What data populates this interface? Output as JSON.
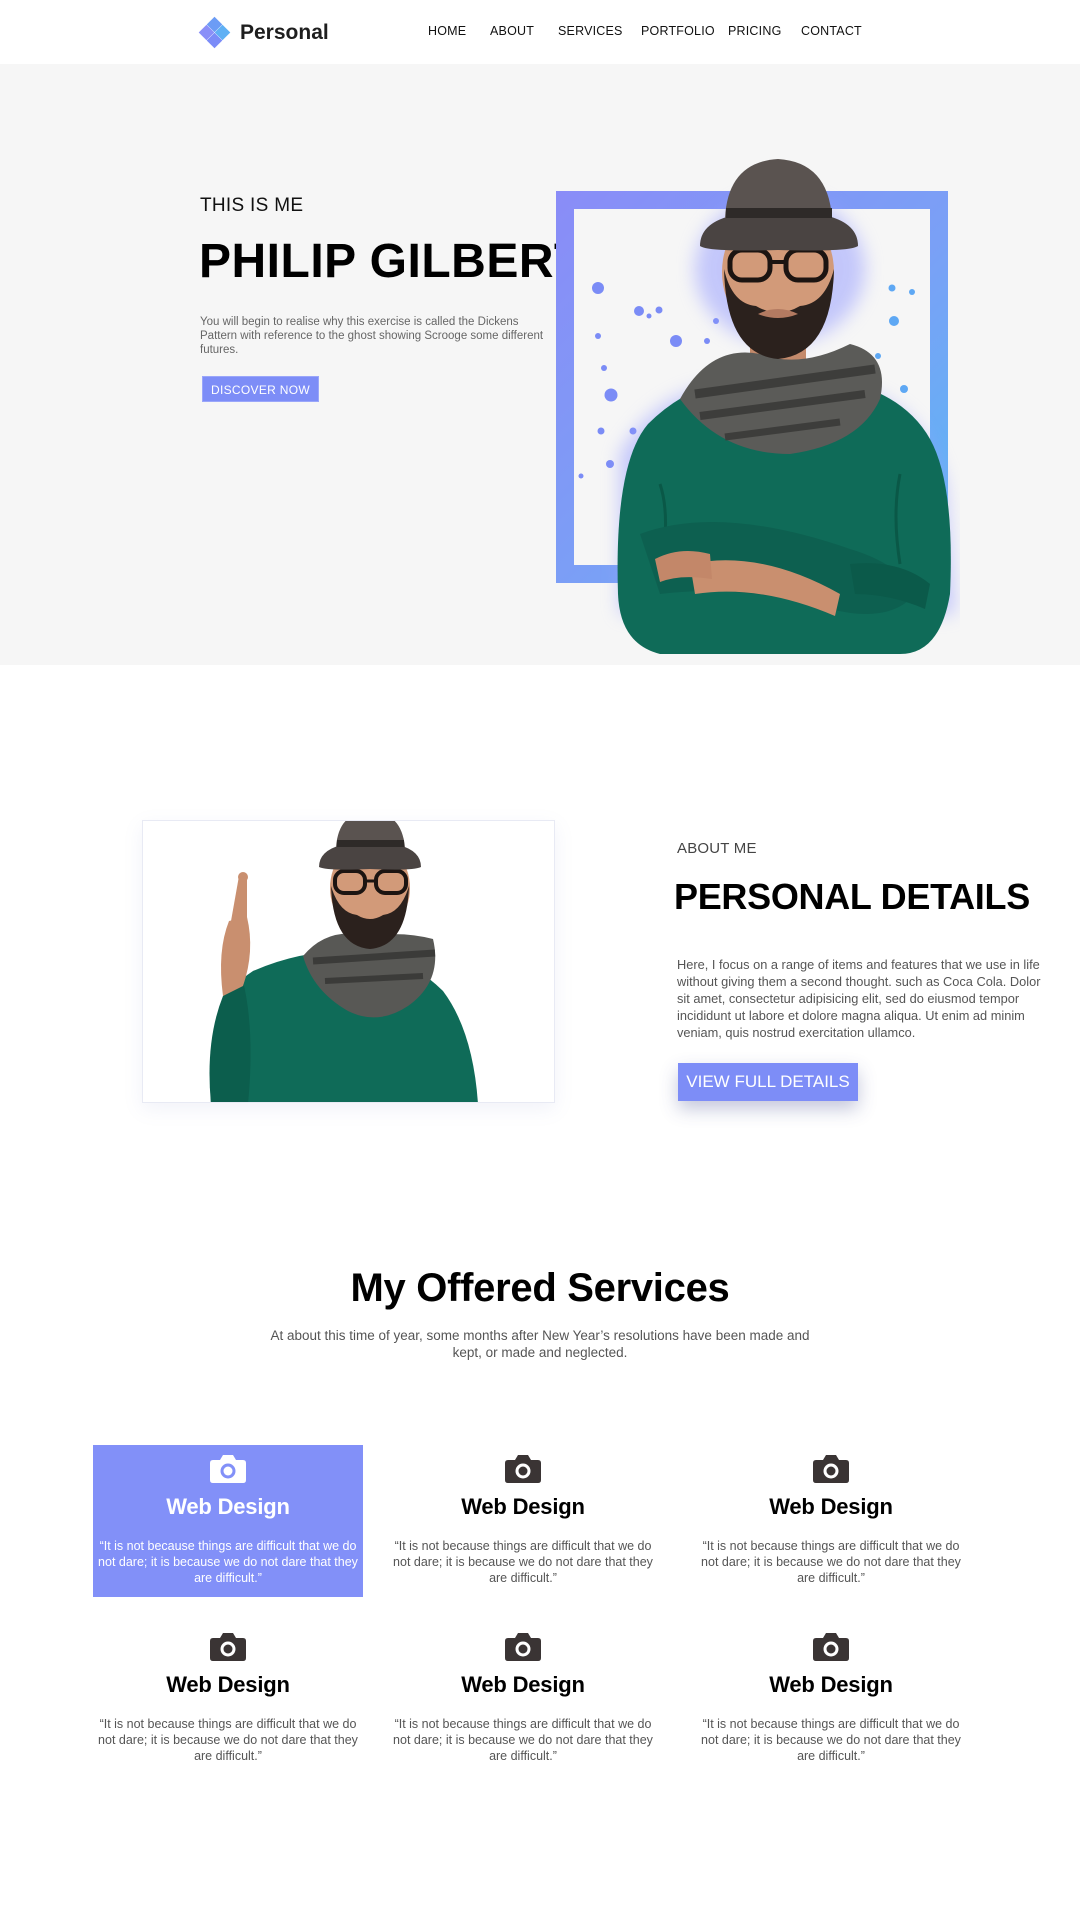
{
  "nav": {
    "logo_text": "Personal",
    "items": [
      "HOME",
      "ABOUT",
      "SERVICES",
      "PORTFOLIO",
      "PRICING",
      "CONTACT"
    ]
  },
  "hero": {
    "kicker": "THIS IS ME",
    "name": "PHILIP GILBERT",
    "description": "You will begin to realise why this exercise is called the Dickens Pattern with reference to the ghost showing Scrooge some different futures.",
    "button": "DISCOVER NOW"
  },
  "about": {
    "kicker": "ABOUT ME",
    "title": "PERSONAL DETAILS",
    "text": "Here, I focus on a range of items and features that we use in life without giving them a second thought. such as Coca Cola. Dolor sit amet, consectetur adipisicing elit, sed do eiusmod tempor incididunt ut labore et dolore magna aliqua. Ut enim ad minim veniam, quis nostrud exercitation ullamco.",
    "button": "VIEW FULL DETAILS"
  },
  "services": {
    "title": "My Offered Services",
    "subtitle": "At about this time of year, some months after New Year’s resolutions have been made and kept, or made and neglected.",
    "cards": [
      {
        "icon": "camera-icon",
        "title": "Web Design",
        "text": "“It is not because things are difficult that we do not dare; it is because we do not dare that they are difficult.”",
        "active": true
      },
      {
        "icon": "camera-icon",
        "title": "Web Design",
        "text": "“It is not because things are difficult that we do not dare; it is because we do not dare that they are difficult.”",
        "active": false
      },
      {
        "icon": "camera-icon",
        "title": "Web Design",
        "text": "“It is not because things are difficult that we do not dare; it is because we do not dare that they are difficult.”",
        "active": false
      },
      {
        "icon": "camera-icon",
        "title": "Web Design",
        "text": "“It is not because things are difficult that we do not dare; it is because we do not dare that they are difficult.”",
        "active": false
      },
      {
        "icon": "camera-icon",
        "title": "Web Design",
        "text": "“It is not because things are difficult that we do not dare; it is because we do not dare that they are difficult.”",
        "active": false
      },
      {
        "icon": "camera-icon",
        "title": "Web Design",
        "text": "“It is not because things are difficult that we do not dare; it is because we do not dare that they are difficult.”",
        "active": false
      }
    ]
  },
  "colors": {
    "accent": "#7d8df7",
    "hero_background": "#f6f6f6",
    "sweater": "#0f6b58"
  }
}
